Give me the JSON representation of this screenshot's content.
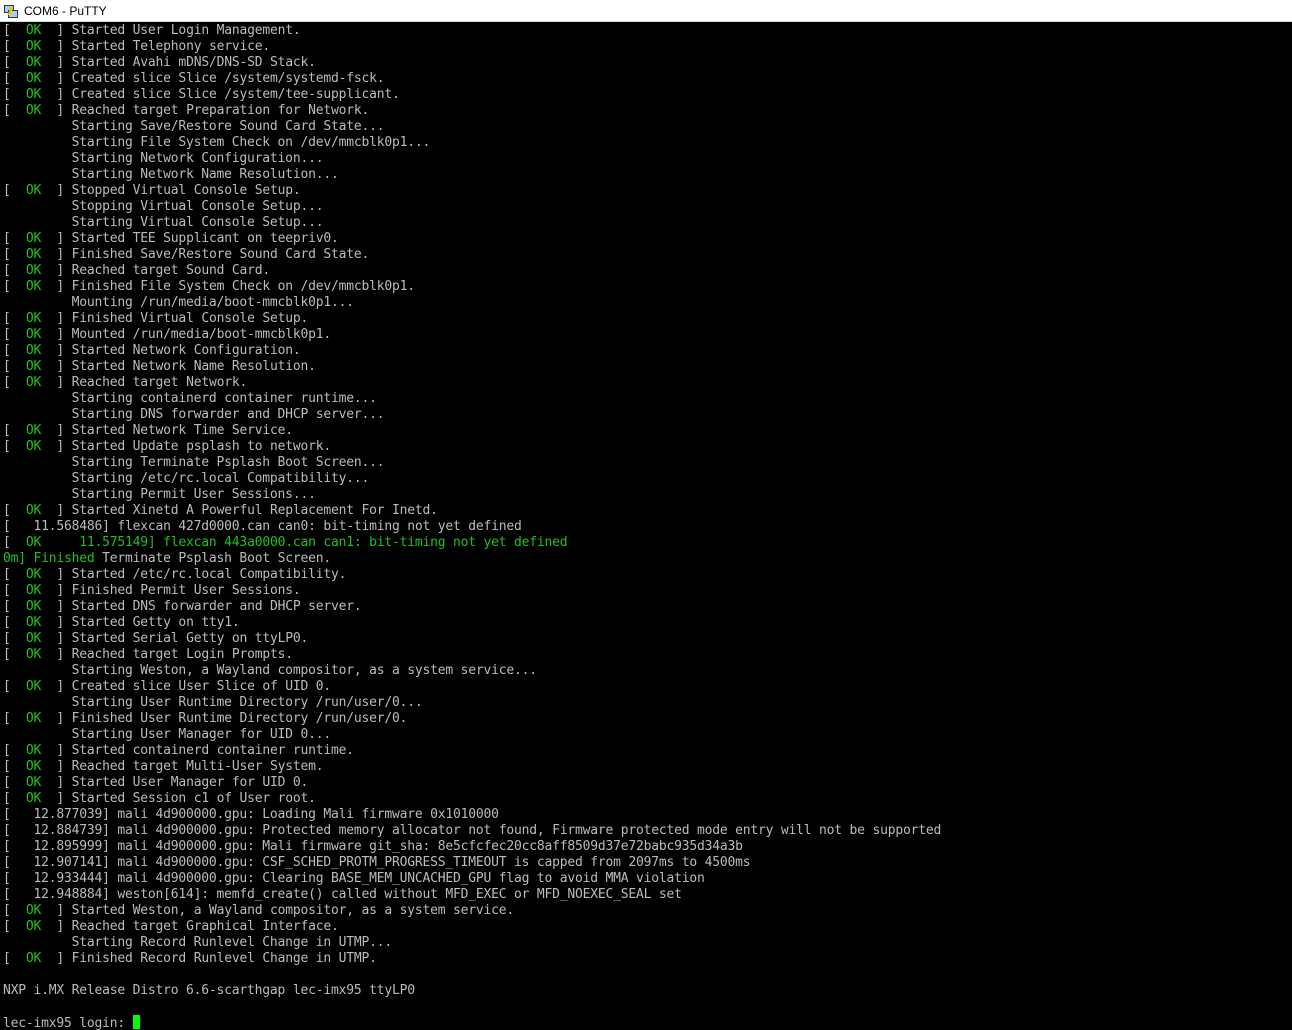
{
  "window": {
    "title": "COM6 - PuTTY"
  },
  "terminal": {
    "lines": [
      [
        [
          "w",
          "[  "
        ],
        [
          "g",
          "OK"
        ],
        [
          "w",
          "  ] Started User Login Management."
        ]
      ],
      [
        [
          "w",
          "[  "
        ],
        [
          "g",
          "OK"
        ],
        [
          "w",
          "  ] Started Telephony service."
        ]
      ],
      [
        [
          "w",
          "[  "
        ],
        [
          "g",
          "OK"
        ],
        [
          "w",
          "  ] Started Avahi mDNS/DNS-SD Stack."
        ]
      ],
      [
        [
          "w",
          "[  "
        ],
        [
          "g",
          "OK"
        ],
        [
          "w",
          "  ] Created slice Slice /system/systemd-fsck."
        ]
      ],
      [
        [
          "w",
          "[  "
        ],
        [
          "g",
          "OK"
        ],
        [
          "w",
          "  ] Created slice Slice /system/tee-supplicant."
        ]
      ],
      [
        [
          "w",
          "[  "
        ],
        [
          "g",
          "OK"
        ],
        [
          "w",
          "  ] Reached target Preparation for Network."
        ]
      ],
      [
        [
          "w",
          "         Starting Save/Restore Sound Card State..."
        ]
      ],
      [
        [
          "w",
          "         Starting File System Check on /dev/mmcblk0p1..."
        ]
      ],
      [
        [
          "w",
          "         Starting Network Configuration..."
        ]
      ],
      [
        [
          "w",
          "         Starting Network Name Resolution..."
        ]
      ],
      [
        [
          "w",
          "[  "
        ],
        [
          "g",
          "OK"
        ],
        [
          "w",
          "  ] Stopped Virtual Console Setup."
        ]
      ],
      [
        [
          "w",
          "         Stopping Virtual Console Setup..."
        ]
      ],
      [
        [
          "w",
          "         Starting Virtual Console Setup..."
        ]
      ],
      [
        [
          "w",
          "[  "
        ],
        [
          "g",
          "OK"
        ],
        [
          "w",
          "  ] Started TEE Supplicant on teepriv0."
        ]
      ],
      [
        [
          "w",
          "[  "
        ],
        [
          "g",
          "OK"
        ],
        [
          "w",
          "  ] Finished Save/Restore Sound Card State."
        ]
      ],
      [
        [
          "w",
          "[  "
        ],
        [
          "g",
          "OK"
        ],
        [
          "w",
          "  ] Reached target Sound Card."
        ]
      ],
      [
        [
          "w",
          "[  "
        ],
        [
          "g",
          "OK"
        ],
        [
          "w",
          "  ] Finished File System Check on /dev/mmcblk0p1."
        ]
      ],
      [
        [
          "w",
          "         Mounting /run/media/boot-mmcblk0p1..."
        ]
      ],
      [
        [
          "w",
          "[  "
        ],
        [
          "g",
          "OK"
        ],
        [
          "w",
          "  ] Finished Virtual Console Setup."
        ]
      ],
      [
        [
          "w",
          "[  "
        ],
        [
          "g",
          "OK"
        ],
        [
          "w",
          "  ] Mounted /run/media/boot-mmcblk0p1."
        ]
      ],
      [
        [
          "w",
          "[  "
        ],
        [
          "g",
          "OK"
        ],
        [
          "w",
          "  ] Started Network Configuration."
        ]
      ],
      [
        [
          "w",
          "[  "
        ],
        [
          "g",
          "OK"
        ],
        [
          "w",
          "  ] Started Network Name Resolution."
        ]
      ],
      [
        [
          "w",
          "[  "
        ],
        [
          "g",
          "OK"
        ],
        [
          "w",
          "  ] Reached target Network."
        ]
      ],
      [
        [
          "w",
          "         Starting containerd container runtime..."
        ]
      ],
      [
        [
          "w",
          "         Starting DNS forwarder and DHCP server..."
        ]
      ],
      [
        [
          "w",
          "[  "
        ],
        [
          "g",
          "OK"
        ],
        [
          "w",
          "  ] Started Network Time Service."
        ]
      ],
      [
        [
          "w",
          "[  "
        ],
        [
          "g",
          "OK"
        ],
        [
          "w",
          "  ] Started Update psplash to network."
        ]
      ],
      [
        [
          "w",
          "         Starting Terminate Psplash Boot Screen..."
        ]
      ],
      [
        [
          "w",
          "         Starting /etc/rc.local Compatibility..."
        ]
      ],
      [
        [
          "w",
          "         Starting Permit User Sessions..."
        ]
      ],
      [
        [
          "w",
          "[  "
        ],
        [
          "g",
          "OK"
        ],
        [
          "w",
          "  ] Started Xinetd A Powerful Replacement For Inetd."
        ]
      ],
      [
        [
          "w",
          "[   11.568486] flexcan 427d0000.can can0: bit-timing not yet defined"
        ]
      ],
      [
        [
          "w",
          "[  "
        ],
        [
          "g",
          "OK     11.575149] flexcan 443a0000.can can1: bit-timing not yet defined"
        ]
      ],
      [
        [
          "g",
          "0m] Finished "
        ],
        [
          "w",
          "Terminate Psplash Boot Screen."
        ]
      ],
      [
        [
          "w",
          "[  "
        ],
        [
          "g",
          "OK"
        ],
        [
          "w",
          "  ] Started /etc/rc.local Compatibility."
        ]
      ],
      [
        [
          "w",
          "[  "
        ],
        [
          "g",
          "OK"
        ],
        [
          "w",
          "  ] Finished Permit User Sessions."
        ]
      ],
      [
        [
          "w",
          "[  "
        ],
        [
          "g",
          "OK"
        ],
        [
          "w",
          "  ] Started DNS forwarder and DHCP server."
        ]
      ],
      [
        [
          "w",
          "[  "
        ],
        [
          "g",
          "OK"
        ],
        [
          "w",
          "  ] Started Getty on tty1."
        ]
      ],
      [
        [
          "w",
          "[  "
        ],
        [
          "g",
          "OK"
        ],
        [
          "w",
          "  ] Started Serial Getty on ttyLP0."
        ]
      ],
      [
        [
          "w",
          "[  "
        ],
        [
          "g",
          "OK"
        ],
        [
          "w",
          "  ] Reached target Login Prompts."
        ]
      ],
      [
        [
          "w",
          "         Starting Weston, a Wayland compositor, as a system service..."
        ]
      ],
      [
        [
          "w",
          "[  "
        ],
        [
          "g",
          "OK"
        ],
        [
          "w",
          "  ] Created slice User Slice of UID 0."
        ]
      ],
      [
        [
          "w",
          "         Starting User Runtime Directory /run/user/0..."
        ]
      ],
      [
        [
          "w",
          "[  "
        ],
        [
          "g",
          "OK"
        ],
        [
          "w",
          "  ] Finished User Runtime Directory /run/user/0."
        ]
      ],
      [
        [
          "w",
          "         Starting User Manager for UID 0..."
        ]
      ],
      [
        [
          "w",
          "[  "
        ],
        [
          "g",
          "OK"
        ],
        [
          "w",
          "  ] Started containerd container runtime."
        ]
      ],
      [
        [
          "w",
          "[  "
        ],
        [
          "g",
          "OK"
        ],
        [
          "w",
          "  ] Reached target Multi-User System."
        ]
      ],
      [
        [
          "w",
          "[  "
        ],
        [
          "g",
          "OK"
        ],
        [
          "w",
          "  ] Started User Manager for UID 0."
        ]
      ],
      [
        [
          "w",
          "[  "
        ],
        [
          "g",
          "OK"
        ],
        [
          "w",
          "  ] Started Session c1 of User root."
        ]
      ],
      [
        [
          "w",
          "[   12.877039] mali 4d900000.gpu: Loading Mali firmware 0x1010000"
        ]
      ],
      [
        [
          "w",
          "[   12.884739] mali 4d900000.gpu: Protected memory allocator not found, Firmware protected mode entry will not be supported"
        ]
      ],
      [
        [
          "w",
          "[   12.895999] mali 4d900000.gpu: Mali firmware git_sha: 8e5cfcfec20cc8aff8509d37e72babc935d34a3b"
        ]
      ],
      [
        [
          "w",
          "[   12.907141] mali 4d900000.gpu: CSF_SCHED_PROTM_PROGRESS_TIMEOUT is capped from 2097ms to 4500ms"
        ]
      ],
      [
        [
          "w",
          "[   12.933444] mali 4d900000.gpu: Clearing BASE_MEM_UNCACHED_GPU flag to avoid MMA violation"
        ]
      ],
      [
        [
          "w",
          "[   12.948884] weston[614]: memfd_create() called without MFD_EXEC or MFD_NOEXEC_SEAL set"
        ]
      ],
      [
        [
          "w",
          "[  "
        ],
        [
          "g",
          "OK"
        ],
        [
          "w",
          "  ] Started Weston, a Wayland compositor, as a system service."
        ]
      ],
      [
        [
          "w",
          "[  "
        ],
        [
          "g",
          "OK"
        ],
        [
          "w",
          "  ] Reached target Graphical Interface."
        ]
      ],
      [
        [
          "w",
          "         Starting Record Runlevel Change in UTMP..."
        ]
      ],
      [
        [
          "w",
          "[  "
        ],
        [
          "g",
          "OK"
        ],
        [
          "w",
          "  ] Finished Record Runlevel Change in UTMP."
        ]
      ],
      [
        [
          "w",
          ""
        ]
      ],
      [
        [
          "w",
          "NXP i.MX Release Distro 6.6-scarthgap lec-imx95 ttyLP0"
        ]
      ],
      [
        [
          "w",
          ""
        ]
      ]
    ],
    "prompt": "lec-imx95 login: "
  }
}
